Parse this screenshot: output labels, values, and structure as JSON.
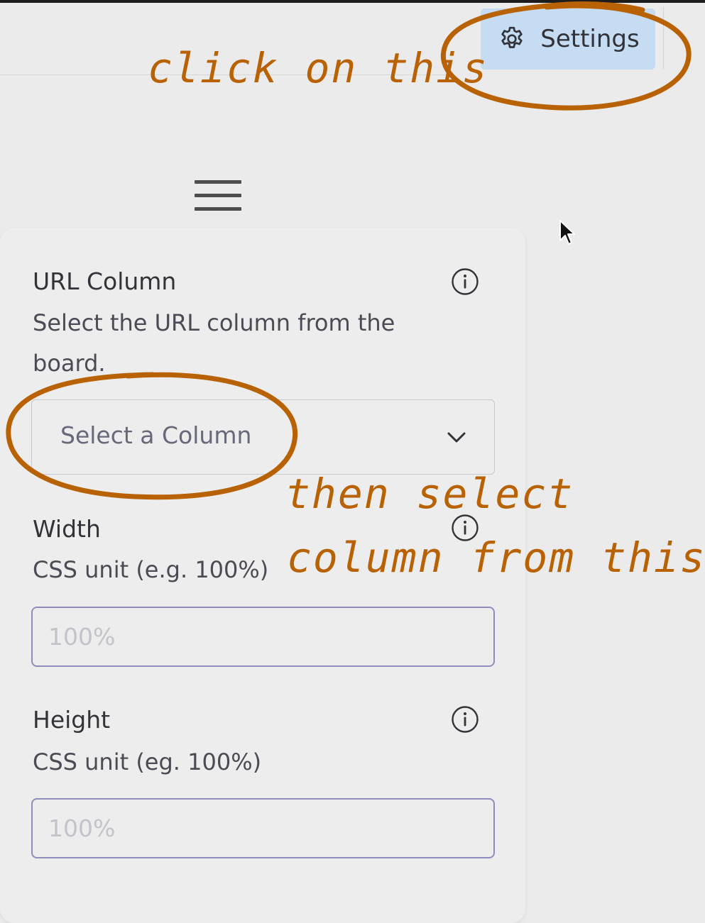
{
  "toolbar": {
    "settings_label": "Settings",
    "settings_icon": "gear-icon"
  },
  "panel": {
    "url_column": {
      "label": "URL Column",
      "help": "Select the URL column from the board.",
      "select_placeholder": "Select a Column"
    },
    "width": {
      "label": "Width",
      "help": "CSS unit (e.g. 100%)",
      "placeholder": "100%"
    },
    "height": {
      "label": "Height",
      "help": "CSS unit (eg. 100%)",
      "placeholder": "100%"
    }
  },
  "annotations": {
    "click_note": "click on this",
    "select_note_line1": "then select",
    "select_note_line2": "column from this",
    "color": "#b86204"
  },
  "colors": {
    "settings_bg": "#c5dcf2",
    "input_border": "#8f8dbd",
    "background": "#ebebeb"
  }
}
